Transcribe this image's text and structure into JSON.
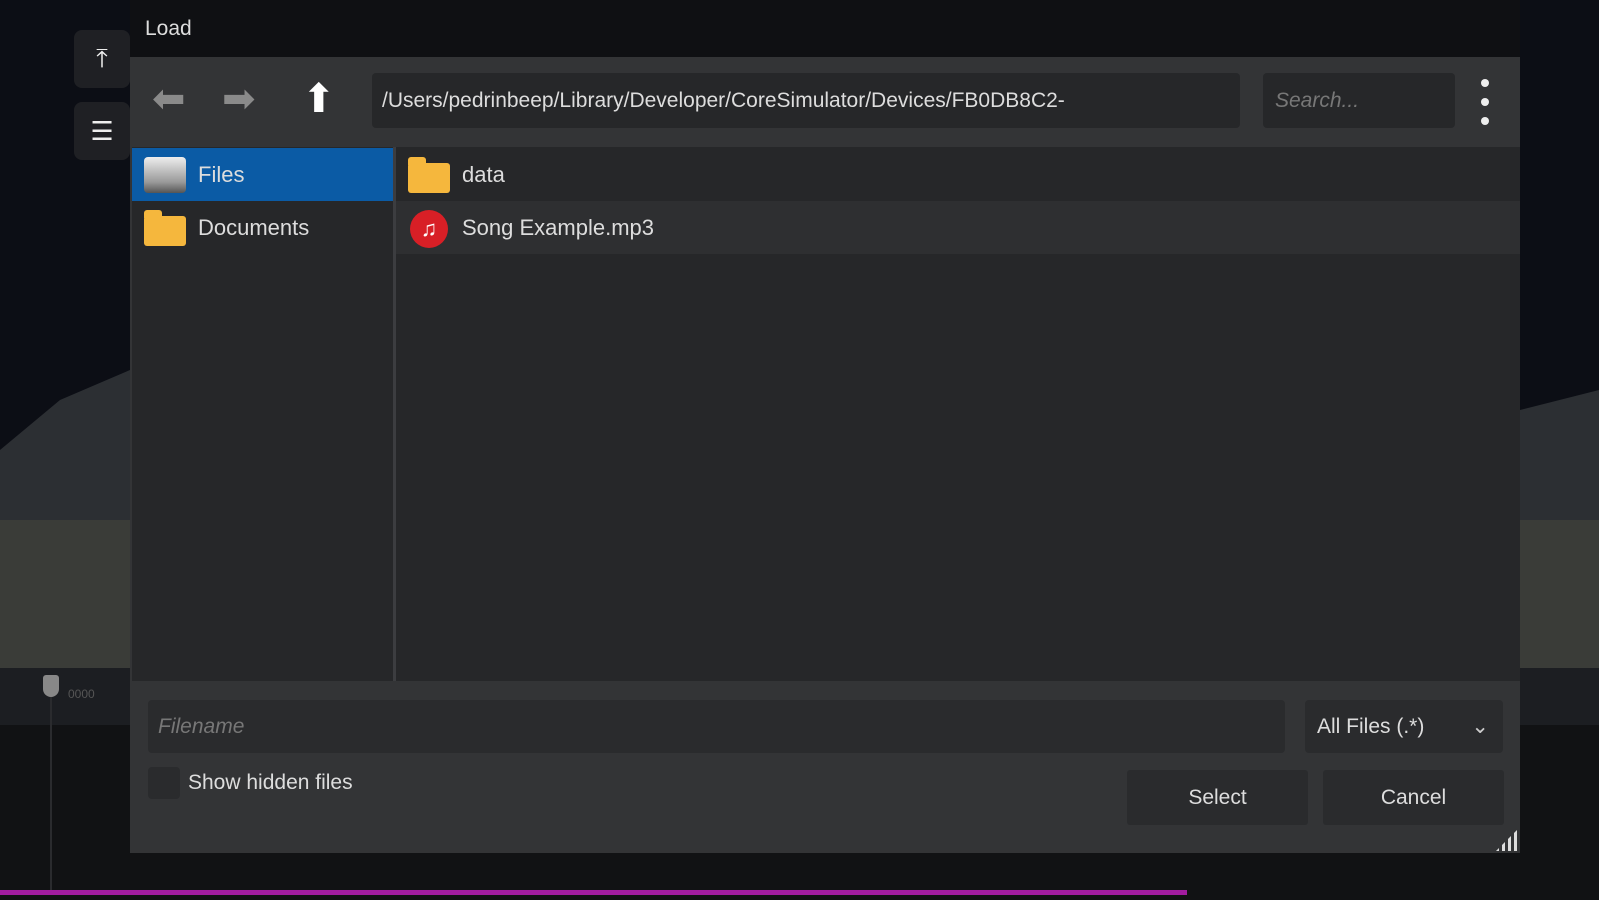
{
  "dialog": {
    "title": "Load"
  },
  "toolbar": {
    "back_icon": "back-arrow-icon",
    "forward_icon": "forward-arrow-icon",
    "up_icon": "up-arrow-icon",
    "path": "/Users/pedrinbeep/Library/Developer/CoreSimulator/Devices/FB0DB8C2-",
    "search_placeholder": "Search..."
  },
  "sidebar": {
    "items": [
      {
        "label": "Files",
        "icon": "drive-icon",
        "selected": true
      },
      {
        "label": "Documents",
        "icon": "folder-icon",
        "selected": false
      }
    ]
  },
  "files": [
    {
      "name": "data",
      "icon": "folder-icon"
    },
    {
      "name": "Song Example.mp3",
      "icon": "music-file-icon"
    }
  ],
  "footer": {
    "filename_placeholder": "Filename",
    "filter": "All Files (.*)",
    "show_hidden_label": "Show hidden files",
    "show_hidden": false,
    "select_label": "Select",
    "cancel_label": "Cancel"
  },
  "background": {
    "marker_label": "0000",
    "progress_color": "#a21ca0"
  }
}
